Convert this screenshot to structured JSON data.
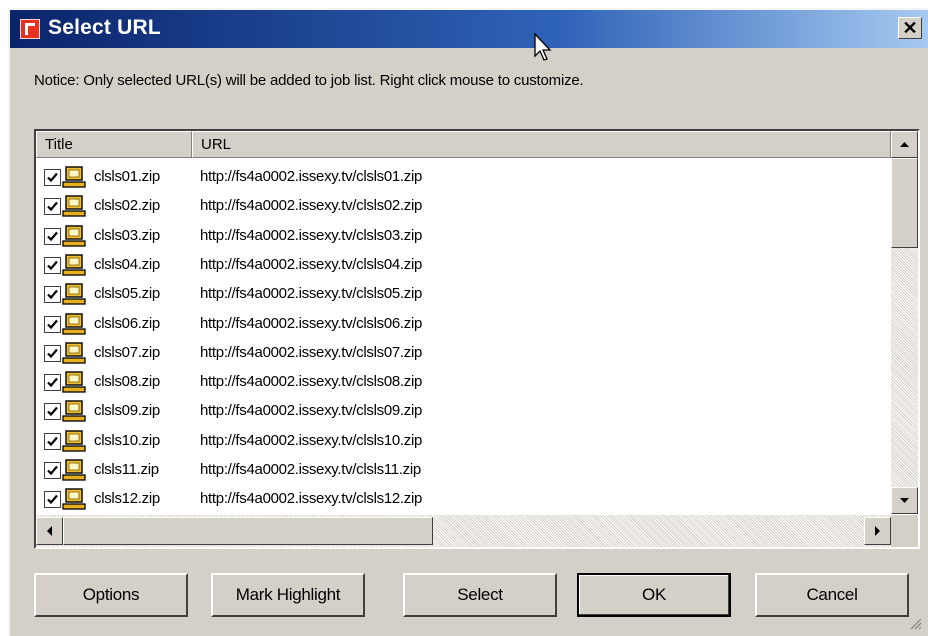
{
  "window": {
    "title": "Select URL",
    "close_glyph": "✕"
  },
  "notice": "Notice: Only selected URL(s) will be added to job list. Right click mouse to customize.",
  "columns": {
    "title": "Title",
    "url": "URL"
  },
  "rows": [
    {
      "title": "clsls01.zip",
      "url": "http://fs4a0002.issexy.tv/clsls01.zip",
      "checked": true
    },
    {
      "title": "clsls02.zip",
      "url": "http://fs4a0002.issexy.tv/clsls02.zip",
      "checked": true
    },
    {
      "title": "clsls03.zip",
      "url": "http://fs4a0002.issexy.tv/clsls03.zip",
      "checked": true
    },
    {
      "title": "clsls04.zip",
      "url": "http://fs4a0002.issexy.tv/clsls04.zip",
      "checked": true
    },
    {
      "title": "clsls05.zip",
      "url": "http://fs4a0002.issexy.tv/clsls05.zip",
      "checked": true
    },
    {
      "title": "clsls06.zip",
      "url": "http://fs4a0002.issexy.tv/clsls06.zip",
      "checked": true
    },
    {
      "title": "clsls07.zip",
      "url": "http://fs4a0002.issexy.tv/clsls07.zip",
      "checked": true
    },
    {
      "title": "clsls08.zip",
      "url": "http://fs4a0002.issexy.tv/clsls08.zip",
      "checked": true
    },
    {
      "title": "clsls09.zip",
      "url": "http://fs4a0002.issexy.tv/clsls09.zip",
      "checked": true
    },
    {
      "title": "clsls10.zip",
      "url": "http://fs4a0002.issexy.tv/clsls10.zip",
      "checked": true
    },
    {
      "title": "clsls11.zip",
      "url": "http://fs4a0002.issexy.tv/clsls11.zip",
      "checked": true
    },
    {
      "title": "clsls12.zip",
      "url": "http://fs4a0002.issexy.tv/clsls12.zip",
      "checked": true
    }
  ],
  "buttons": {
    "options": "Options",
    "mark_highlight": "Mark Highlight",
    "select": "Select",
    "ok": "OK",
    "cancel": "Cancel"
  },
  "icons": {
    "app": "app-icon",
    "row": "computer-icon",
    "check": "checkmark-icon"
  },
  "colors": {
    "title_bar_start": "#0a246a",
    "title_bar_end": "#a6caf0",
    "face": "#d4d0c8",
    "app_icon": "#e8321e",
    "file_icon": "#f0c030"
  }
}
